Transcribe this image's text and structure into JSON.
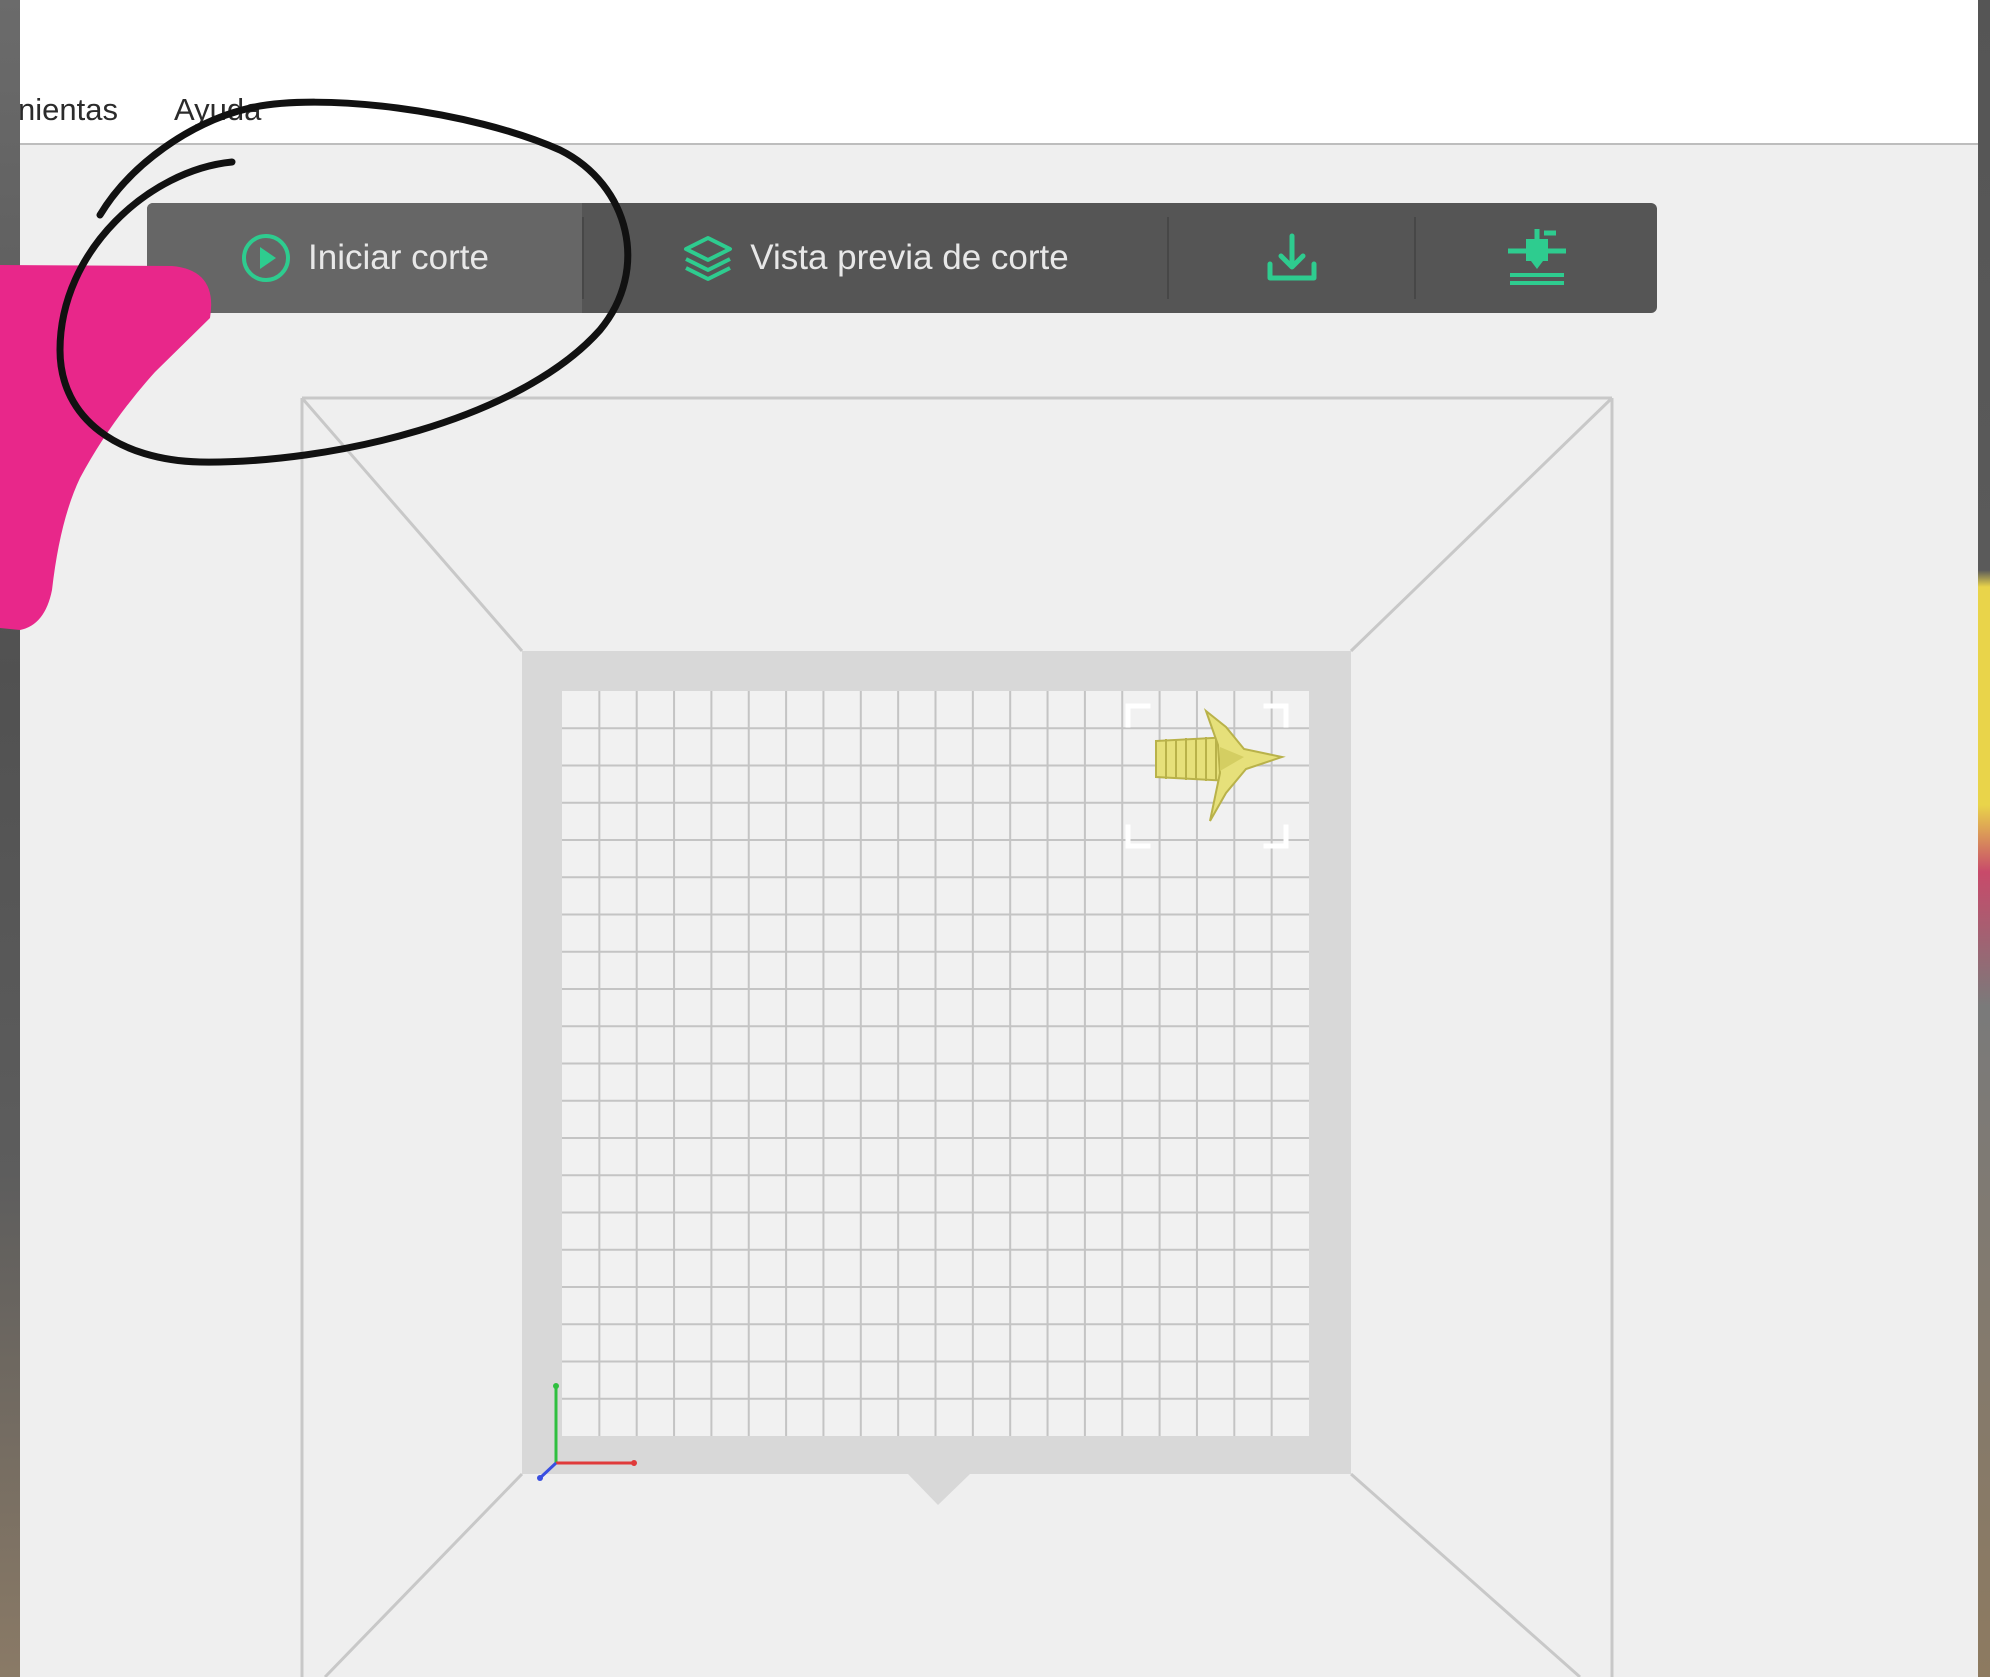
{
  "menu": {
    "items": [
      {
        "label": "nientas"
      },
      {
        "label": "Ayuda"
      }
    ]
  },
  "toolbar": {
    "start_slice_label": "Iniciar corte",
    "preview_label": "Vista previa de corte",
    "accent_color": "#2ecc8f"
  },
  "icons": {
    "start": "play-circle-icon",
    "preview": "layers-icon",
    "export": "download-icon",
    "print": "printer-nozzle-icon"
  },
  "colors": {
    "toolbar_bg": "#555555",
    "active_button_bg": "#666666",
    "model_color": "#e6e07a",
    "annotation_pink": "#e8278a",
    "annotation_ink": "#111111"
  }
}
